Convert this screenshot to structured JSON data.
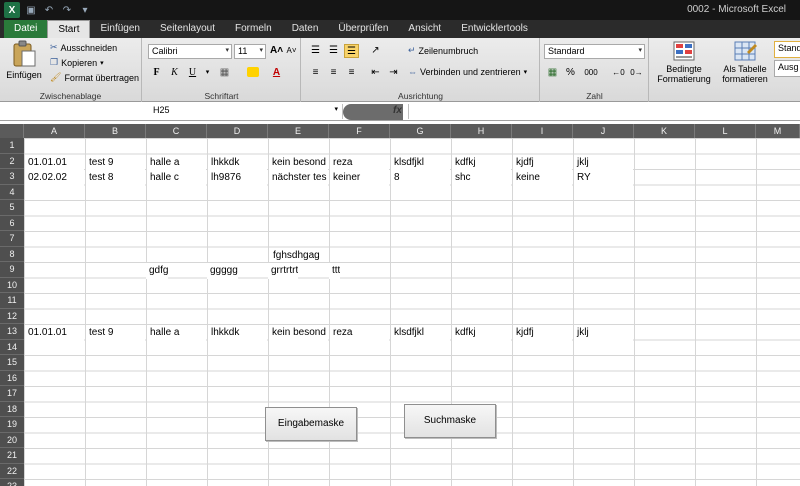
{
  "window": {
    "title": "0002 - Microsoft Excel"
  },
  "tabs": [
    "Datei",
    "Start",
    "Einfügen",
    "Seitenlayout",
    "Formeln",
    "Daten",
    "Überprüfen",
    "Ansicht",
    "Entwicklertools"
  ],
  "ribbon": {
    "clipboard": {
      "paste": "Einfügen",
      "cut": "Ausschneiden",
      "copy": "Kopieren",
      "format_painter": "Format übertragen",
      "label": "Zwischenablage"
    },
    "font": {
      "name": "Calibri",
      "size": "11",
      "label": "Schriftart",
      "bold": "F",
      "italic": "K",
      "underline": "U"
    },
    "alignment": {
      "wrap": "Zeilenumbruch",
      "merge": "Verbinden und zentrieren",
      "label": "Ausrichtung"
    },
    "number": {
      "format": "Standard",
      "label": "Zahl",
      "percent": "%",
      "thousands": "000"
    },
    "styles": {
      "conditional_line1": "Bedingte",
      "conditional_line2": "Formatierung",
      "table_line1": "Als Tabelle",
      "table_line2": "formatieren",
      "style1": "Stand",
      "style2": "Ausg"
    }
  },
  "formula_bar": {
    "name_box": "H25",
    "fx": "fx",
    "content": ""
  },
  "columns": [
    "A",
    "B",
    "C",
    "D",
    "E",
    "F",
    "G",
    "H",
    "I",
    "J",
    "K",
    "L",
    "M"
  ],
  "rows": [
    "1",
    "2",
    "3",
    "4",
    "5",
    "6",
    "7",
    "8",
    "9",
    "10",
    "11",
    "12",
    "13",
    "14",
    "15",
    "16",
    "17",
    "18",
    "19",
    "20",
    "21",
    "22",
    "23"
  ],
  "cells": {
    "r2": [
      "01.01.01",
      "test 9",
      "halle a",
      "lhkkdk",
      "kein besond",
      "reza",
      "klsdfjkl",
      "kdfkj",
      "kjdfj",
      "jklj"
    ],
    "r3": [
      "02.02.02",
      "test 8",
      "halle c",
      "lh9876",
      "nächster tes",
      "keiner",
      "8",
      "shc",
      "keine",
      "RY"
    ],
    "e8": "fghsdhgag",
    "c9": "gdfg",
    "d9": "ggggg",
    "e9": "grrtrtrt",
    "f9": "ttt",
    "r13": [
      "01.01.01",
      "test 9",
      "halle a",
      "lhkkdk",
      "kein besond",
      "reza",
      "klsdfjkl",
      "kdfkj",
      "kjdfj",
      "jklj"
    ]
  },
  "buttons": {
    "eingabe": "Eingabemaske",
    "such": "Suchmaske"
  },
  "colors": {
    "file_tab": "#2a7a3a",
    "header_bg": "#5b5b5b",
    "title_bg": "#151515"
  }
}
